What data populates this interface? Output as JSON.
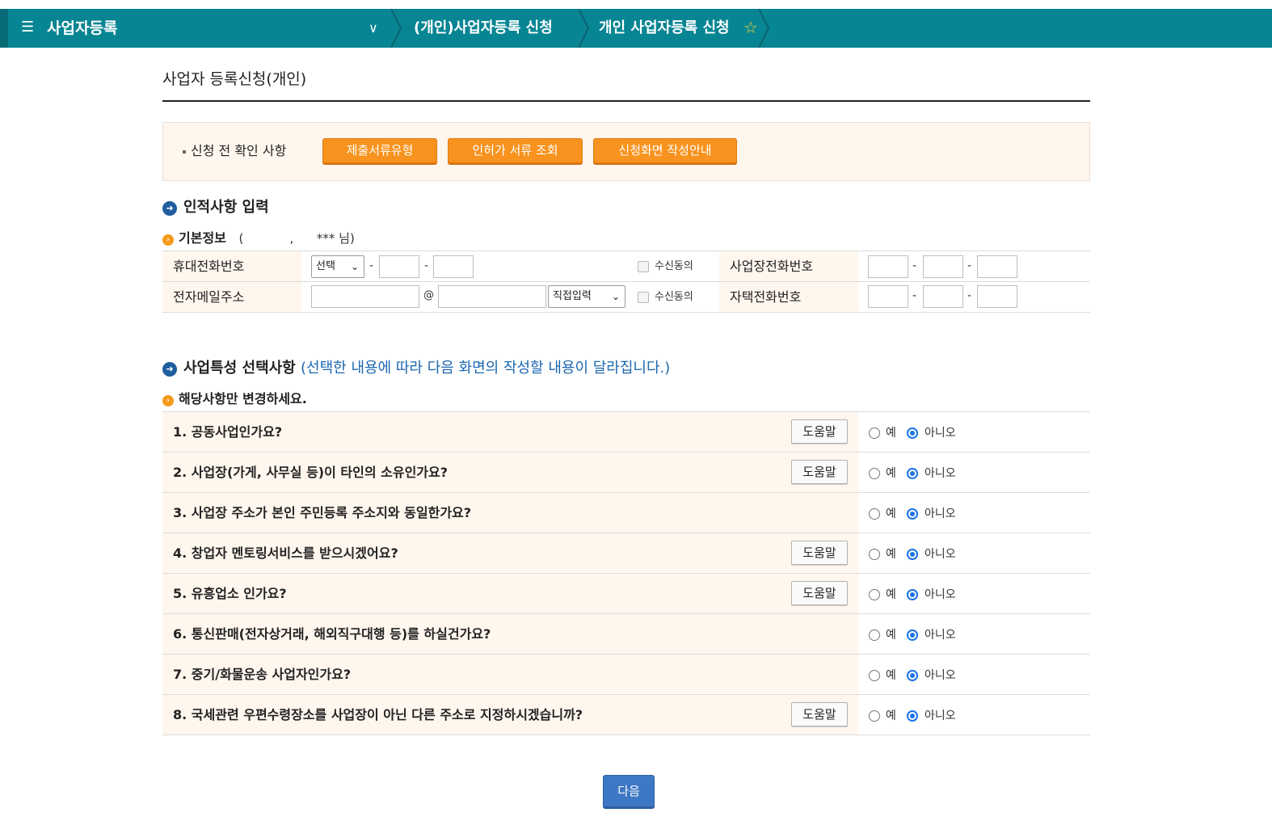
{
  "nav": {
    "title": "사업자등록",
    "crumb2": "(개인)사업자등록 신청",
    "crumb3": "개인 사업자등록 신청"
  },
  "page_title": "사업자 등록신청(개인)",
  "pre_check": {
    "label": "신청 전 확인 사항",
    "buttons": [
      "제출서류유형",
      "인허가 서류 조회",
      "신청화면 작성안내"
    ]
  },
  "personal": {
    "heading": "인적사항 입력",
    "basic_label": "기본정보",
    "basic_detail": "(            ,      *** 님)",
    "mobile_label": "휴대전화번호",
    "mobile_select": "선택",
    "consent_label": "수신동의",
    "biz_phone_label": "사업장전화번호",
    "email_label": "전자메일주소",
    "email_at": "@",
    "email_select": "직접입력",
    "home_phone_label": "자택전화번호",
    "dash": "-"
  },
  "features": {
    "heading": "사업특성 선택사항",
    "heading_note": "(선택한 내용에 따라 다음 화면의 작성할 내용이 달라집니다.)",
    "sub": "해당사항만 변경하세요.",
    "help_label": "도움말",
    "yes_label": "예",
    "no_label": "아니오",
    "questions": [
      {
        "text": "1. 공동사업인가요?",
        "help": true,
        "answer": "no"
      },
      {
        "text": "2. 사업장(가게, 사무실 등)이 타인의 소유인가요?",
        "help": true,
        "answer": "no"
      },
      {
        "text": "3. 사업장 주소가 본인 주민등록 주소지와 동일한가요?",
        "help": false,
        "answer": "no"
      },
      {
        "text": "4. 창업자 멘토링서비스를 받으시겠어요?",
        "help": true,
        "answer": "no"
      },
      {
        "text": "5. 유흥업소 인가요?",
        "help": true,
        "answer": "no"
      },
      {
        "text": "6. 통신판매(전자상거래, 해외직구대행 등)를 하실건가요?",
        "help": false,
        "answer": "no"
      },
      {
        "text": "7. 중기/화물운송 사업자인가요?",
        "help": false,
        "answer": "no"
      },
      {
        "text": "8. 국세관련 우편수령장소를 사업장이 아닌 다른 주소로 지정하시겠습니까?",
        "help": true,
        "answer": "no"
      }
    ]
  },
  "next_label": "다음",
  "colors": {
    "nav_bg": "#088593",
    "orange_button": "#f7931e",
    "label_bg": "#fff6ee",
    "next_button": "#3d78c4",
    "note_text": "#1b67b0"
  },
  "icons": {
    "menu": "hamburger-menu-icon",
    "dropdown": "chevron-down-icon",
    "favorite": "star-outline-icon",
    "section": "arrow-circle-icon",
    "subsection": "chevron-circle-icon"
  }
}
